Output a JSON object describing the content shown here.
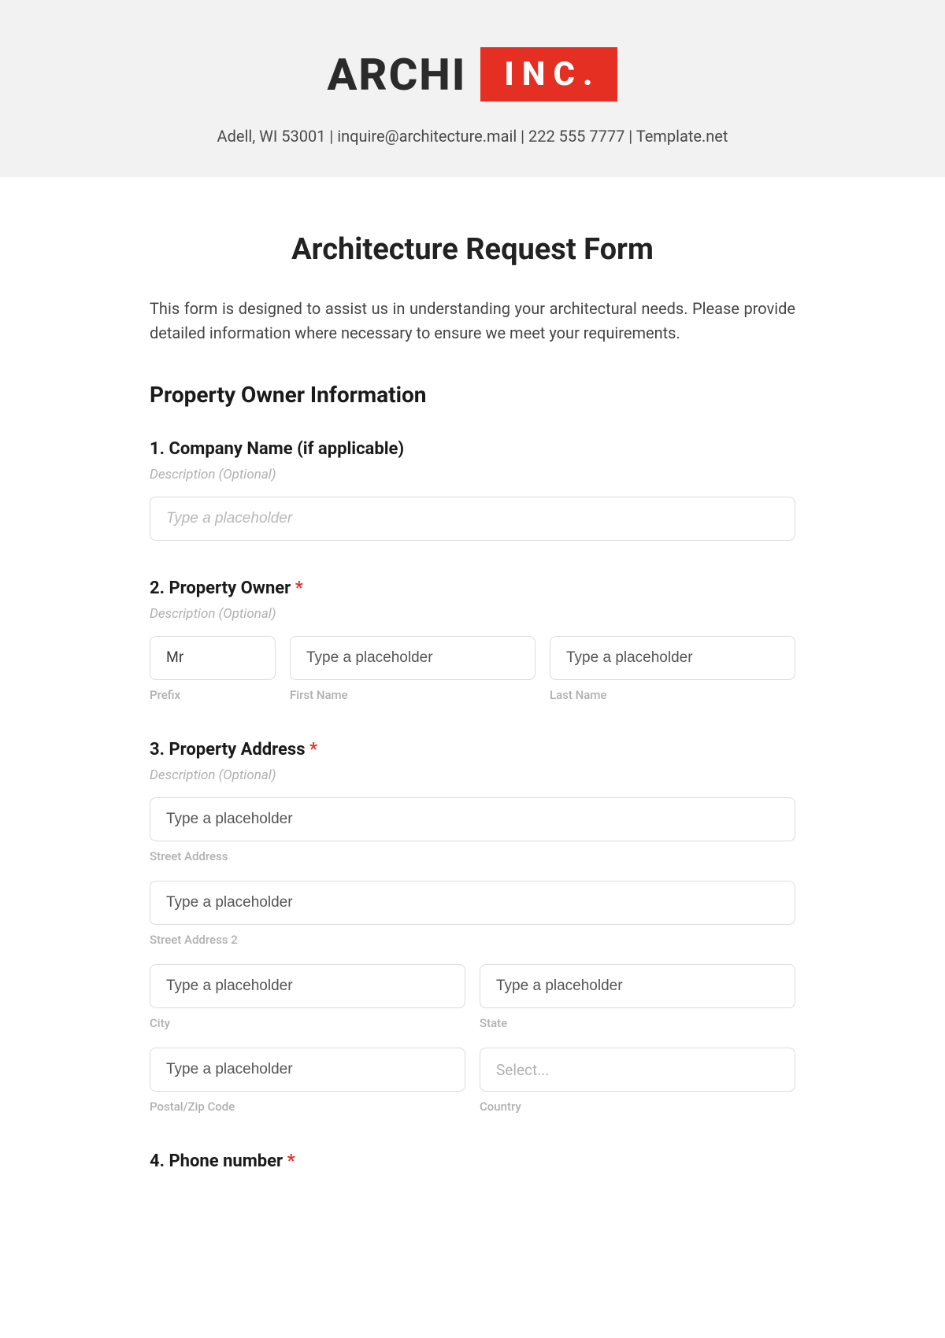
{
  "header": {
    "logo_left": "ARCHI",
    "logo_right": "INC.",
    "contact": "Adell, WI 53001 | inquire@architecture.mail | 222 555 7777 | Template.net"
  },
  "form": {
    "title": "Architecture Request Form",
    "intro": "This form is designed to assist us in understanding your architectural needs. Please provide detailed information where necessary to ensure we meet your requirements.",
    "section1_heading": "Property Owner Information",
    "q1": {
      "label": "1. Company Name (if applicable)",
      "desc": "Description (Optional)",
      "placeholder": "Type a placeholder"
    },
    "q2": {
      "label": "2. Property Owner ",
      "req": "*",
      "desc": "Description (Optional)",
      "prefix_value": "Mr",
      "first_placeholder": "Type a placeholder",
      "last_placeholder": "Type a placeholder",
      "sub_prefix": "Prefix",
      "sub_first": "First Name",
      "sub_last": "Last Name"
    },
    "q3": {
      "label": "3. Property Address ",
      "req": "*",
      "desc": "Description (Optional)",
      "street_ph": "Type a placeholder",
      "street2_ph": "Type a placeholder",
      "city_ph": "Type a placeholder",
      "state_ph": "Type a placeholder",
      "postal_ph": "Type a placeholder",
      "country_ph": "Select...",
      "sub_street": "Street Address",
      "sub_street2": "Street Address 2",
      "sub_city": "City",
      "sub_state": "State",
      "sub_postal": "Postal/Zip Code",
      "sub_country": "Country"
    },
    "q4": {
      "label": "4. Phone number ",
      "req": "*"
    }
  }
}
